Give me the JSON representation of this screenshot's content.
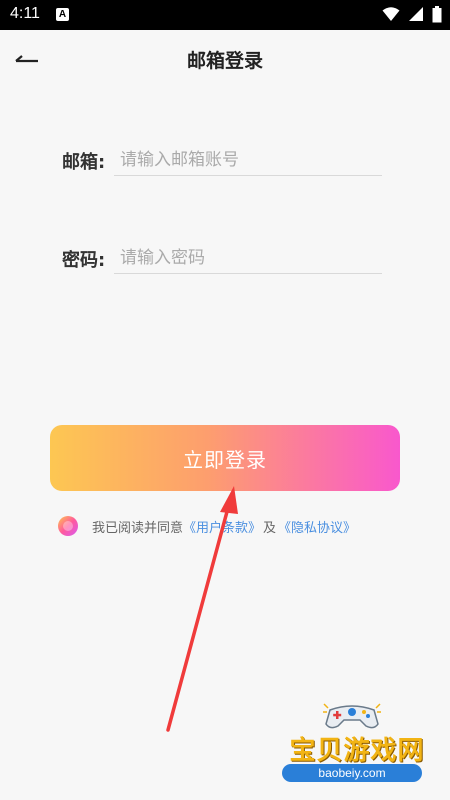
{
  "status_bar": {
    "time": "4:11",
    "notification_icon": "A"
  },
  "header": {
    "title": "邮箱登录",
    "back_icon": "back-arrow-icon"
  },
  "form": {
    "email": {
      "label": "邮箱:",
      "placeholder": "请输入邮箱账号",
      "value": ""
    },
    "password": {
      "label": "密码:",
      "placeholder": "请输入密码",
      "value": ""
    }
  },
  "login_button": {
    "label": "立即登录",
    "gradient": [
      "#fdc752",
      "#fd9e6e",
      "#f958cd"
    ]
  },
  "agreement": {
    "prefix": "我已阅读并同意",
    "terms_link": "《用户条款》",
    "conjunction": "及",
    "privacy_link": "《隐私协议》",
    "link_color": "#4a8fe0"
  },
  "watermark": {
    "name": "宝贝游戏网",
    "url": "baobeiy.com"
  },
  "annotation": {
    "color": "#f03b3b"
  }
}
